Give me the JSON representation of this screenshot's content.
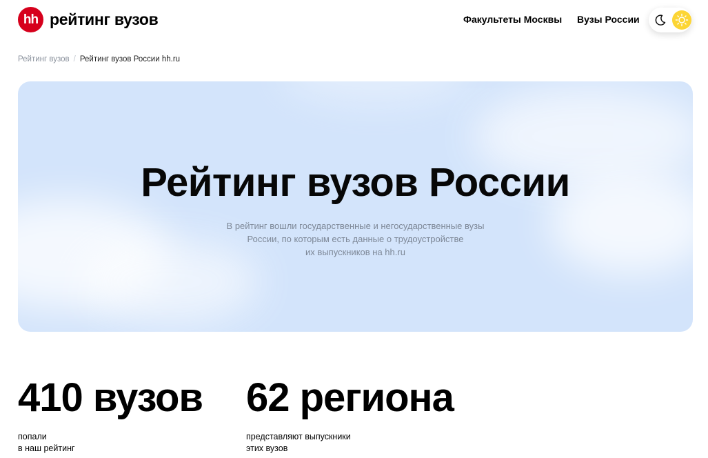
{
  "header": {
    "logo_badge": "hh",
    "logo_text": "рейтинг вузов",
    "nav": [
      "Факультеты Москвы",
      "Вузы России"
    ]
  },
  "breadcrumb": {
    "link": "Рейтинг вузов",
    "separator": "/",
    "current": "Рейтинг вузов России hh.ru"
  },
  "hero": {
    "title": "Рейтинг вузов России",
    "subtitle_lines": [
      "В рейтинг вошли государственные и негосударственные вузы",
      "России, по которым есть данные о трудоустройстве",
      "их выпускников на hh.ru"
    ]
  },
  "stats": [
    {
      "value": "410 вузов",
      "caption_lines": [
        "попали",
        "в наш рейтинг"
      ]
    },
    {
      "value": "62 региона",
      "caption_lines": [
        "представляют выпускники",
        "этих вузов"
      ]
    }
  ],
  "icons": {
    "moon": "moon-icon",
    "sun": "sun-icon"
  },
  "colors": {
    "brand": "#d6001c",
    "hero_bg": "#d3e4fb",
    "sun": "#fcd535"
  }
}
